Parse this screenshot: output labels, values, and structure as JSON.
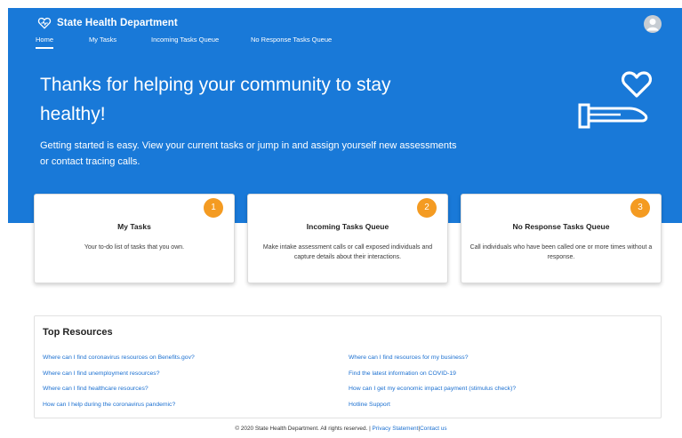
{
  "brand": {
    "name": "State Health Department"
  },
  "nav": {
    "tabs": [
      {
        "label": "Home"
      },
      {
        "label": "My Tasks"
      },
      {
        "label": "Incoming Tasks Queue"
      },
      {
        "label": "No Response Tasks Queue"
      }
    ],
    "active_tab": "Home"
  },
  "hero": {
    "title": "Thanks for helping your community to stay healthy!",
    "subtitle": "Getting started is easy. View your current tasks or jump in and assign yourself new assessments or contact tracing calls."
  },
  "cards": [
    {
      "badge": "1",
      "title": "My Tasks",
      "description": "Your to-do list of tasks that you own."
    },
    {
      "badge": "2",
      "title": "Incoming Tasks Queue",
      "description": "Make intake assessment calls or call exposed individuals and capture details about their interactions."
    },
    {
      "badge": "3",
      "title": "No Response Tasks Queue",
      "description": "Call individuals who have been called one or more times without a response."
    }
  ],
  "resources": {
    "title": "Top Resources",
    "left_links": [
      "Where can I find coronavirus resources on Benefits.gov?",
      "Where can I find unemployment resources?",
      "Where can I find healthcare resources?",
      "How can I help during the coronavirus pandemic?"
    ],
    "right_links": [
      "Where can I find resources for my business?",
      "Find the latest information on COVID-19",
      "How can I get my economic impact payment (stimulus check)?",
      "Hotline Support"
    ]
  },
  "footer": {
    "copyright": "© 2020 State Health Department. All rights reserved.",
    "separator": "|",
    "privacy": "Privacy Statement",
    "contact": "Contact us"
  },
  "colors": {
    "hero_blue": "#1979d8",
    "badge_orange": "#f49b22",
    "link_blue": "#1a6fd0"
  },
  "icons": {
    "brand": "heart-pulse-icon",
    "avatar": "user-avatar-icon",
    "hero_art": "hand-holding-heart-icon"
  }
}
